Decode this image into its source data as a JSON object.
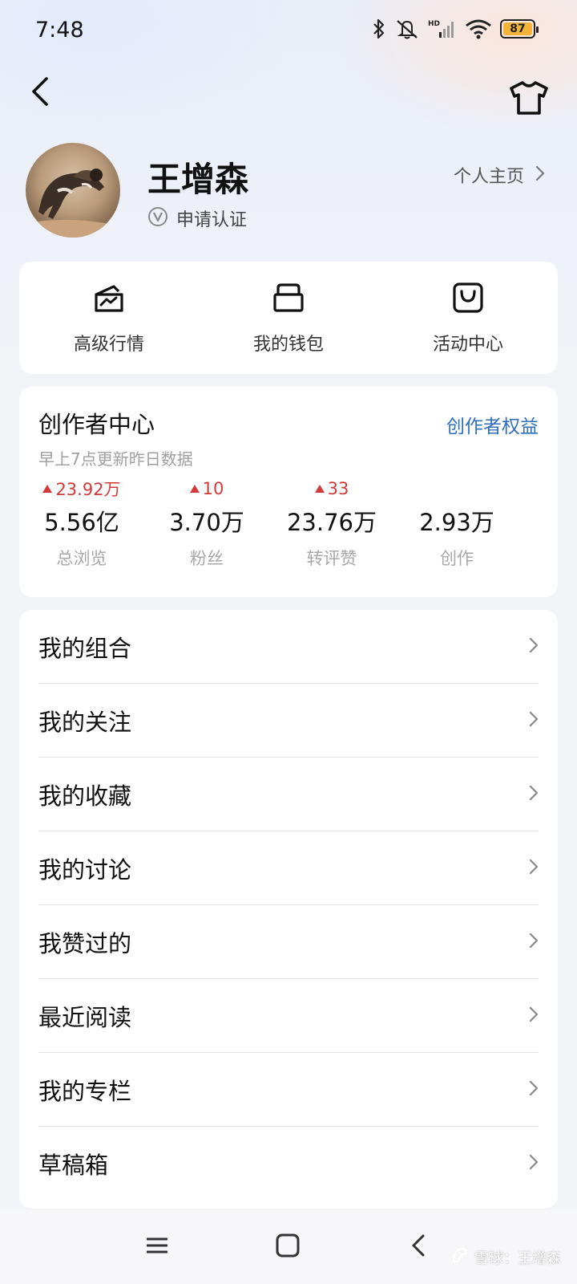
{
  "status_bar": {
    "time": "7:48",
    "battery_level": "87",
    "icons": [
      "bluetooth-icon",
      "mute-icon",
      "hd-signal-icon",
      "wifi-icon",
      "battery-icon"
    ]
  },
  "nav": {
    "back_icon": "back-arrow-icon",
    "skin_icon": "tshirt-icon"
  },
  "profile": {
    "name": "王增森",
    "verify_label": "申请认证",
    "homepage_label": "个人主页"
  },
  "quick_actions": [
    {
      "label": "高级行情",
      "icon": "market-icon"
    },
    {
      "label": "我的钱包",
      "icon": "wallet-icon"
    },
    {
      "label": "活动中心",
      "icon": "activity-icon"
    }
  ],
  "creator_center": {
    "title": "创作者中心",
    "rights_link": "创作者权益",
    "update_note": "早上7点更新昨日数据",
    "stats": [
      {
        "delta": "23.92万",
        "value": "5.56亿",
        "label": "总浏览"
      },
      {
        "delta": "10",
        "value": "3.70万",
        "label": "粉丝"
      },
      {
        "delta": "33",
        "value": "23.76万",
        "label": "转评赞"
      },
      {
        "delta": "",
        "value": "2.93万",
        "label": "创作"
      }
    ]
  },
  "menu": [
    {
      "label": "我的组合"
    },
    {
      "label": "我的关注"
    },
    {
      "label": "我的收藏"
    },
    {
      "label": "我的讨论"
    },
    {
      "label": "我赞过的"
    },
    {
      "label": "最近阅读"
    },
    {
      "label": "我的专栏"
    },
    {
      "label": "草稿箱"
    }
  ],
  "system_nav": [
    "menu-icon",
    "home-square-icon",
    "back-chevron-icon"
  ],
  "watermark": "雪球：王增森",
  "colors": {
    "accent_blue": "#2f6fbe",
    "increase_red": "#d23a3a",
    "battery_yellow": "#f3b33a"
  }
}
